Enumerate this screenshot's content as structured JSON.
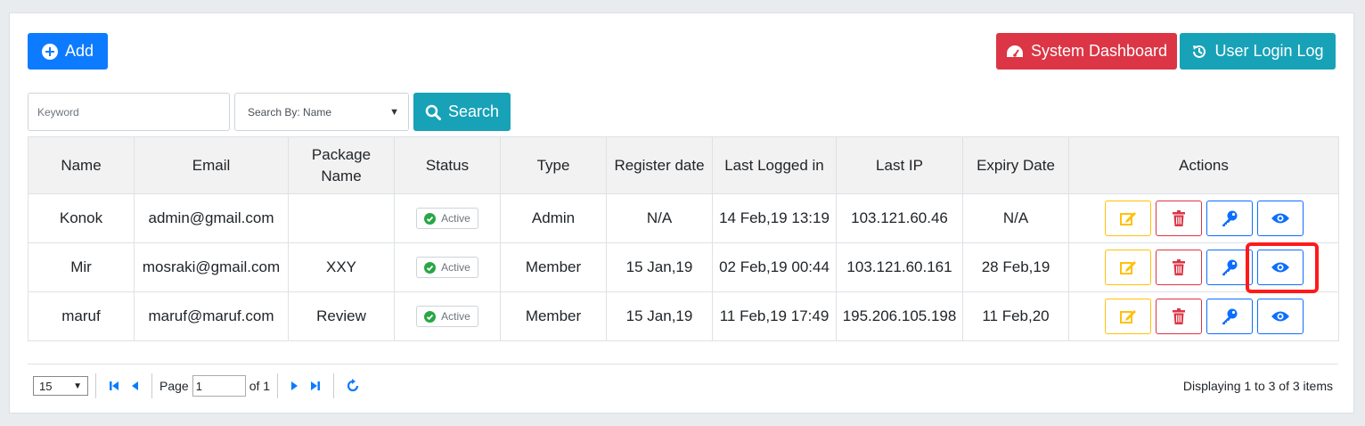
{
  "toolbar": {
    "add_label": "Add",
    "dashboard_label": "System Dashboard",
    "login_log_label": "User Login Log"
  },
  "search": {
    "keyword_placeholder": "Keyword",
    "search_by_value": "Search By: Name",
    "button_label": "Search"
  },
  "table": {
    "headers": {
      "name": "Name",
      "email": "Email",
      "package": "Package Name",
      "status": "Status",
      "type": "Type",
      "register": "Register date",
      "last_logged": "Last Logged in",
      "last_ip": "Last IP",
      "expiry": "Expiry Date",
      "actions": "Actions"
    },
    "rows": [
      {
        "name": "Konok",
        "email": "admin@gmail.com",
        "package": "",
        "status": "Active",
        "type": "Admin",
        "register": "N/A",
        "last_logged": "14 Feb,19 13:19",
        "last_ip": "103.121.60.46",
        "expiry": "N/A"
      },
      {
        "name": "Mir",
        "email": "mosraki@gmail.com",
        "package": "XXY",
        "status": "Active",
        "type": "Member",
        "register": "15 Jan,19",
        "last_logged": "02 Feb,19 00:44",
        "last_ip": "103.121.60.161",
        "expiry": "28 Feb,19"
      },
      {
        "name": "maruf",
        "email": "maruf@maruf.com",
        "package": "Review",
        "status": "Active",
        "type": "Member",
        "register": "15 Jan,19",
        "last_logged": "11 Feb,19 17:49",
        "last_ip": "195.206.105.198",
        "expiry": "11 Feb,20"
      }
    ]
  },
  "pager": {
    "page_size": "15",
    "page_label": "Page",
    "page_value": "1",
    "of_label": "of 1",
    "display_info": "Displaying 1 to 3 of 3 items"
  },
  "colors": {
    "primary": "#0d7bff",
    "danger": "#dc3545",
    "info": "#17a2b8",
    "warning": "#ffc107",
    "success": "#28a745",
    "highlight": "#ff1a1a"
  }
}
